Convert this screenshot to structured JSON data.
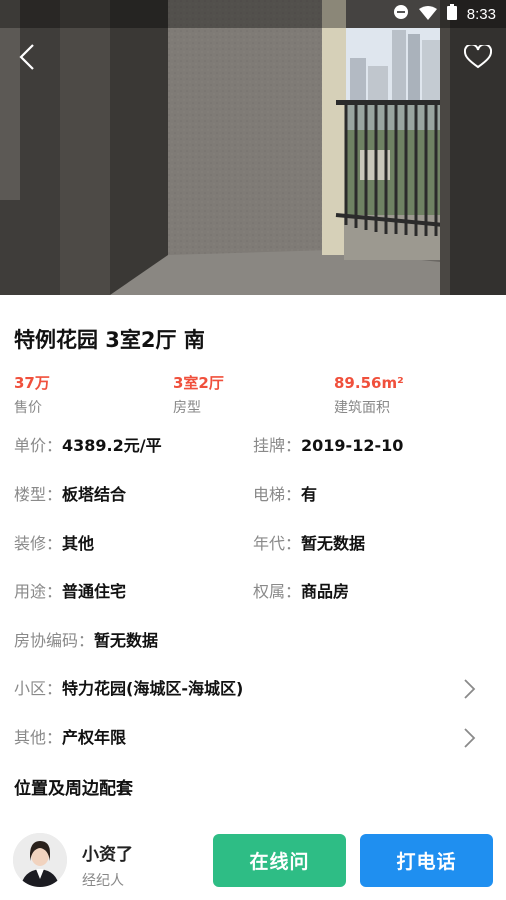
{
  "status_bar": {
    "time": "8:33"
  },
  "listing": {
    "title": "特例花园 3室2厅 南",
    "key_figures": [
      {
        "value": "37万",
        "label": "售价"
      },
      {
        "value": "3室2厅",
        "label": "房型"
      },
      {
        "value": "89.56m²",
        "label": "建筑面积"
      }
    ],
    "unit_price": {
      "key": "单价：",
      "value": "4389.2元/平"
    },
    "listed": {
      "key": "挂牌：",
      "value": "2019-12-10"
    },
    "building_type": {
      "key": "楼型：",
      "value": "板塔结合"
    },
    "elevator": {
      "key": "电梯：",
      "value": "有"
    },
    "decoration": {
      "key": "装修：",
      "value": "其他"
    },
    "year": {
      "key": "年代：",
      "value": "暂无数据"
    },
    "usage": {
      "key": "用途：",
      "value": "普通住宅"
    },
    "ownership": {
      "key": "权属：",
      "value": "商品房"
    },
    "assoc_code": {
      "key": "房协编码：",
      "value": "暂无数据"
    },
    "community": {
      "key": "小区：",
      "value": "特力花园(海城区-海城区)"
    },
    "other": {
      "key": "其他：",
      "value": "产权年限"
    },
    "surroundings_title": "位置及周边配套"
  },
  "agent": {
    "name": "小资了",
    "role": "经纪人",
    "chat_label": "在线问",
    "call_label": "打电话"
  },
  "colors": {
    "accent_red": "#f0503c",
    "chat_green": "#2ebd85",
    "call_blue": "#1f8ff0"
  }
}
